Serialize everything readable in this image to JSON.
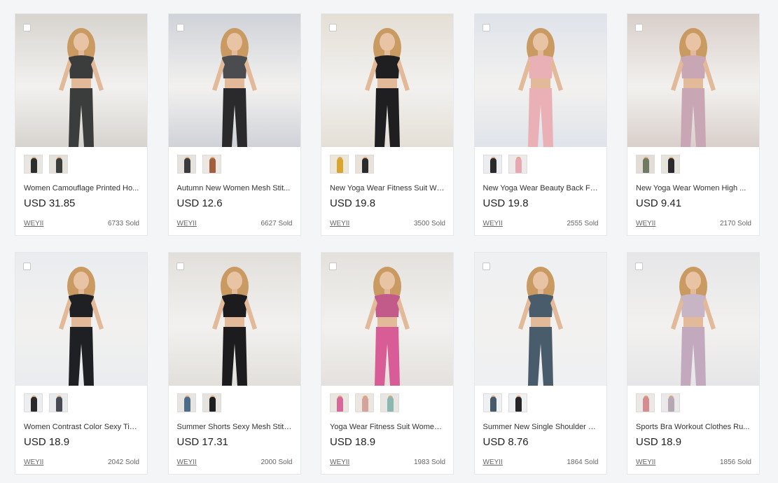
{
  "products": [
    {
      "title": "Women Camouflage Printed Ho...",
      "price": "USD 31.85",
      "brand": "WEYII",
      "sold": "6733 Sold",
      "bg": "#d7d4cf",
      "colors": [
        "#3a3d3b",
        "#3a3d3b"
      ],
      "thumbs": [
        {
          "bg": "#e9e6e1",
          "c": "#2d2f2e"
        },
        {
          "bg": "#e4e0da",
          "c": "#3a3d3b"
        }
      ]
    },
    {
      "title": "Autumn New Women Mesh Stit...",
      "price": "USD 12.6",
      "brand": "WEYII",
      "sold": "6627 Sold",
      "bg": "#cfd2d8",
      "colors": [
        "#4b4c50",
        "#2a2a2c"
      ],
      "thumbs": [
        {
          "bg": "#e6e3df",
          "c": "#3b3b3e"
        },
        {
          "bg": "#ece7e2",
          "c": "#a0603d"
        }
      ]
    },
    {
      "title": "New Yoga Wear Fitness Suit Wo...",
      "price": "USD 19.8",
      "brand": "WEYII",
      "sold": "3500 Sold",
      "bg": "#e4dfd6",
      "colors": [
        "#1f1f22",
        "#1f1f22"
      ],
      "thumbs": [
        {
          "bg": "#efe7d6",
          "c": "#d9a530"
        },
        {
          "bg": "#e8e2d8",
          "c": "#2a2a2c"
        }
      ]
    },
    {
      "title": "New Yoga Wear Beauty Back Fit...",
      "price": "USD 19.8",
      "brand": "WEYII",
      "sold": "2555 Sold",
      "bg": "#dfe3ea",
      "colors": [
        "#e9b1b6",
        "#e9b1b6"
      ],
      "thumbs": [
        {
          "bg": "#ecedf0",
          "c": "#2a2a2c"
        },
        {
          "bg": "#efeaea",
          "c": "#e6a9b2"
        }
      ]
    },
    {
      "title": "New Yoga Wear Women High ...",
      "price": "USD 9.41",
      "brand": "WEYII",
      "sold": "2170 Sold",
      "bg": "#d9cfca",
      "colors": [
        "#c9a6b4",
        "#c9a6b4"
      ],
      "thumbs": [
        {
          "bg": "#e3ddd5",
          "c": "#6f7a62"
        },
        {
          "bg": "#e6e2dc",
          "c": "#2a2a2c"
        }
      ]
    },
    {
      "title": "Women Contrast Color Sexy Tig...",
      "price": "USD 18.9",
      "brand": "WEYII",
      "sold": "2042 Sold",
      "bg": "#e9ecef",
      "colors": [
        "#1f2024",
        "#1f2024"
      ],
      "thumbs": [
        {
          "bg": "#eceef0",
          "c": "#2a2a2c"
        },
        {
          "bg": "#e8eaec",
          "c": "#474a52"
        }
      ]
    },
    {
      "title": "Summer Shorts Sexy Mesh Stitc...",
      "price": "USD 17.31",
      "brand": "WEYII",
      "sold": "2000 Sold",
      "bg": "#e2dfdb",
      "colors": [
        "#1c1c1e",
        "#1c1c1e"
      ],
      "thumbs": [
        {
          "bg": "#e8e4df",
          "c": "#4c6d8a"
        },
        {
          "bg": "#e6e3df",
          "c": "#1f1f21"
        }
      ]
    },
    {
      "title": "Yoga Wear Fitness Suit Women ...",
      "price": "USD 18.9",
      "brand": "WEYII",
      "sold": "1983 Sold",
      "bg": "#e4e1dd",
      "colors": [
        "#c25a8a",
        "#d85d97"
      ],
      "thumbs": [
        {
          "bg": "#ebe6e2",
          "c": "#d6699a"
        },
        {
          "bg": "#ece6e1",
          "c": "#d4a49a"
        },
        {
          "bg": "#e8e6e2",
          "c": "#8cb7b0"
        }
      ]
    },
    {
      "title": "Summer New Single Shoulder S...",
      "price": "USD 8.76",
      "brand": "WEYII",
      "sold": "1864 Sold",
      "bg": "#eef0f2",
      "colors": [
        "#485c6c",
        "#485c6c"
      ],
      "thumbs": [
        {
          "bg": "#eef0f2",
          "c": "#475a69"
        },
        {
          "bg": "#eef0f2",
          "c": "#252527"
        }
      ]
    },
    {
      "title": "Sports Bra Workout Clothes Ru...",
      "price": "USD 18.9",
      "brand": "WEYII",
      "sold": "1856 Sold",
      "bg": "#e6e6e8",
      "colors": [
        "#c7b4c4",
        "#c2a9bd"
      ],
      "thumbs": [
        {
          "bg": "#ece8e6",
          "c": "#d38d90"
        },
        {
          "bg": "#eae8e9",
          "c": "#b4a9b3"
        }
      ]
    }
  ]
}
